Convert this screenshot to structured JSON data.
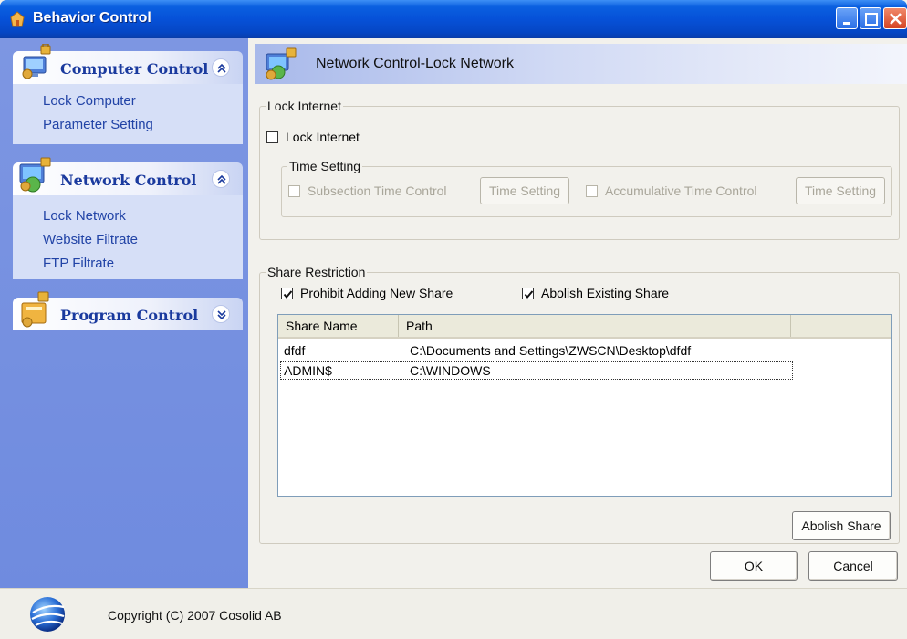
{
  "window": {
    "title": "Behavior Control"
  },
  "sidebar": {
    "groups": [
      {
        "label": "Computer Control",
        "items": [
          "Lock Computer",
          "Parameter Setting"
        ],
        "expanded": true
      },
      {
        "label": "Network Control",
        "items": [
          "Lock Network",
          "Website Filtrate",
          "FTP Filtrate"
        ],
        "expanded": true
      },
      {
        "label": "Program Control",
        "items": [],
        "expanded": false
      }
    ]
  },
  "content": {
    "header_title": "Network Control-Lock Network",
    "lock_internet": {
      "group_label": "Lock Internet",
      "checkbox_label": "Lock Internet",
      "checked": false,
      "time_setting": {
        "group_label": "Time Setting",
        "subsection_label": "Subsection Time Control",
        "subsection_button": "Time Setting",
        "accumulative_label": "Accumulative Time Control",
        "accumulative_button": "Time Setting"
      }
    },
    "share_restriction": {
      "group_label": "Share Restriction",
      "prohibit_label": "Prohibit Adding New Share",
      "prohibit_checked": true,
      "abolish_existing_label": "Abolish Existing Share",
      "abolish_existing_checked": true,
      "columns": [
        "Share Name",
        "Path"
      ],
      "rows": [
        {
          "name": "dfdf",
          "path": "C:\\Documents and Settings\\ZWSCN\\Desktop\\dfdf"
        },
        {
          "name": "ADMIN$",
          "path": "C:\\WINDOWS"
        }
      ],
      "abolish_button": "Abolish Share"
    },
    "ok_button": "OK",
    "cancel_button": "Cancel"
  },
  "footer": {
    "copyright": "Copyright (C) 2007 Cosolid AB"
  },
  "colors": {
    "titlebar": "#0651d8",
    "sidebar": "#7d96e2",
    "link": "#2143a6",
    "group_header_text": "#1a3a9e"
  }
}
